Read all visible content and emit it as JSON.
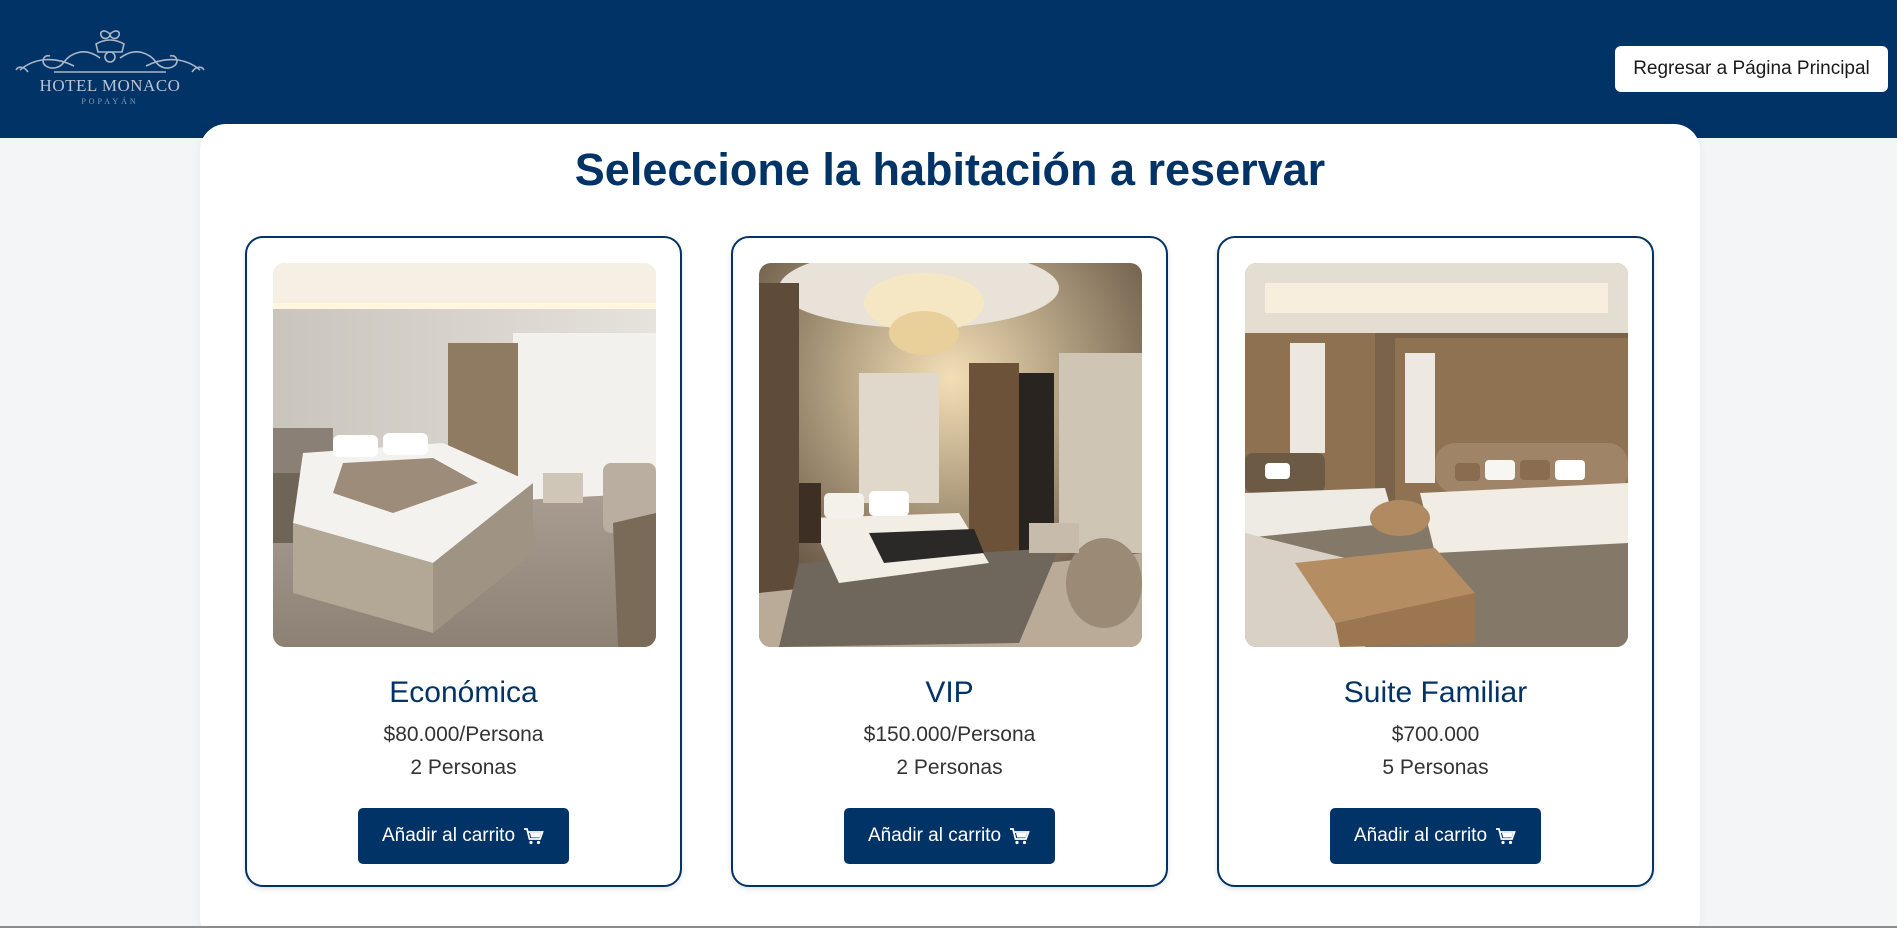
{
  "header": {
    "logo": {
      "title": "HOTEL MONACO",
      "subtitle": "POPAYÁN",
      "icon": "crown-ornament-logo"
    },
    "home_button_label": "Regresar a Página Principal"
  },
  "main": {
    "title": "Seleccione la habitación a reservar",
    "rooms": [
      {
        "name": "Económica",
        "price": "$80.000/Persona",
        "capacity": "2 Personas",
        "button_label": "Añadir al carrito",
        "button_icon": "cart-icon",
        "image": "economy-room-photo"
      },
      {
        "name": "VIP",
        "price": "$150.000/Persona",
        "capacity": "2 Personas",
        "button_label": "Añadir al carrito",
        "button_icon": "cart-icon",
        "image": "vip-room-photo"
      },
      {
        "name": "Suite Familiar",
        "price": "$700.000",
        "capacity": "5 Personas",
        "button_label": "Añadir al carrito",
        "button_icon": "cart-icon",
        "image": "family-suite-photo"
      }
    ]
  },
  "colors": {
    "primary": "#023366",
    "background": "#f3f5f7",
    "card": "#ffffff",
    "text": "#333333"
  }
}
